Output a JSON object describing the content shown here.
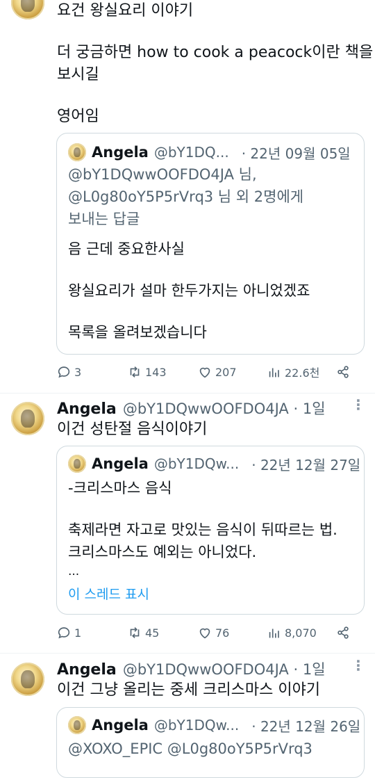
{
  "tweet1": {
    "lines": [
      "요건 왕실요리 이야기",
      "",
      "더 궁금하면 how to cook a peacock이란 책을",
      "보시길",
      "",
      "영어임"
    ],
    "quote": {
      "name": "Angela",
      "handle": "@bY1DQ...",
      "date": "· 22년 09월 05일",
      "reply_to_1": "@bY1DQwwOOFDO4JA 님,",
      "reply_to_2": "@L0g80oY5P5rVrq3 님 외 2명에게",
      "reply_to_3": "보내는 답글",
      "lines": [
        "음 근데 중요한사실",
        "",
        "왕실요리가 설마 한두가지는 아니었겠죠",
        "",
        "목록을 올려보겠습니다"
      ]
    },
    "stats": {
      "replies": "3",
      "retweets": "143",
      "likes": "207",
      "views": "22.6천"
    }
  },
  "tweet2": {
    "name": "Angela",
    "handle_time": "@bY1DQwwOOFDO4JA · 1일",
    "text": "이건 성탄절 음식이야기",
    "quote": {
      "name": "Angela",
      "handle": "@bY1DQw...",
      "date": "· 22년 12월 27일",
      "lines": [
        "-크리스마스 음식",
        "",
        "축제라면 자고로 맛있는 음식이 뒤따르는 법.",
        "크리스마스도 예외는 아니었다.",
        "..."
      ],
      "show_thread": "이 스레드 표시"
    },
    "stats": {
      "replies": "1",
      "retweets": "45",
      "likes": "76",
      "views": "8,070"
    }
  },
  "tweet3": {
    "name": "Angela",
    "handle_time": "@bY1DQwwOOFDO4JA · 1일",
    "text": "이건 그냥 올리는 중세 크리스마스 이야기",
    "quote": {
      "name": "Angela",
      "handle": "@bY1DQw...",
      "date": "· 22년 12월 26일",
      "first_line": "@XOXO_EPIC @L0g80oY5P5rVrq3"
    }
  },
  "colors": {
    "text": "#0f1419",
    "secondary": "#536471",
    "link": "#1d9bf0",
    "border": "#cfd9de"
  }
}
